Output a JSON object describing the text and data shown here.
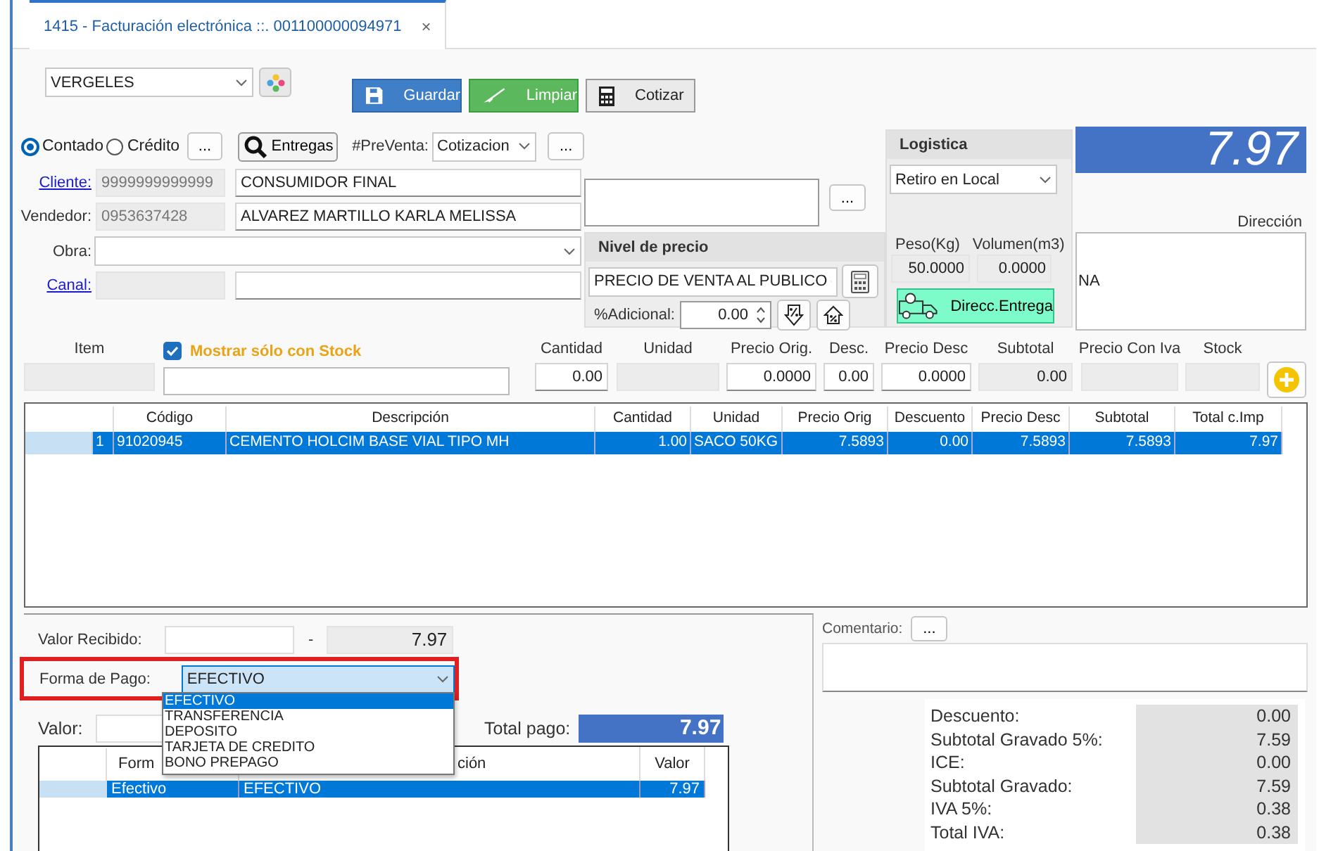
{
  "tab": {
    "title": "1415 - Facturación electrónica ::. 001100000094971",
    "close": "×",
    "selected": true
  },
  "branch": {
    "value": "VERGELES"
  },
  "toolbar": [
    {
      "kind": "save",
      "label": "Guardar"
    },
    {
      "kind": "clear",
      "label": "Limpiar"
    },
    {
      "kind": "quote",
      "label": "Cotizar"
    }
  ],
  "payment_terms": [
    {
      "label": "Contado",
      "selected": true
    },
    {
      "label": "Crédito",
      "selected": false
    }
  ],
  "terms_more": "...",
  "deliveries_button": "Entregas",
  "presale": {
    "label": "#PreVenta:",
    "value": "Cotizacion",
    "more": "..."
  },
  "customer": {
    "label": "Cliente:",
    "id": "9999999999999",
    "name": "CONSUMIDOR FINAL"
  },
  "seller": {
    "label": "Vendedor:",
    "id": "0953637428",
    "name": "ALVAREZ MARTILLO KARLA MELISSA"
  },
  "project": {
    "label": "Obra:"
  },
  "channel": {
    "label": "Canal:"
  },
  "notes_more": "...",
  "price_level": {
    "title": "Nivel de precio",
    "value": "PRECIO DE VENTA AL PUBLICO",
    "extra_label": "%Adicional:",
    "extra_value": "0.00"
  },
  "logistics": {
    "title": "Logistica",
    "mode": "Retiro en Local",
    "weight_label": "Peso(Kg)",
    "weight": "50.0000",
    "volume_label": "Volumen(m3)",
    "volume": "0.0000",
    "delivery_button": "Direcc.Entrega"
  },
  "total": "7.97",
  "address": {
    "label": "Dirección",
    "value": "NA"
  },
  "item_entry": {
    "item_label": "Item",
    "stock_filter": {
      "label": "Mostrar sólo con Stock",
      "checked": true
    },
    "fields": [
      {
        "label": "Cantidad",
        "value": "0.00",
        "disabled": false
      },
      {
        "label": "Unidad",
        "disabled": true
      },
      {
        "label": "Precio Orig.",
        "value": "0.0000",
        "disabled": false
      },
      {
        "label": "Desc.",
        "value": "0.00",
        "disabled": false
      },
      {
        "label": "Precio Desc",
        "value": "0.0000",
        "disabled": false
      },
      {
        "label": "Subtotal",
        "value": "0.00",
        "disabled": true
      },
      {
        "label": "Precio Con Iva",
        "disabled": true
      },
      {
        "label": "Stock",
        "disabled": true
      }
    ]
  },
  "grid": {
    "columns": [
      "Código",
      "Descripción",
      "Cantidad",
      "Unidad",
      "Precio Orig",
      "Descuento",
      "Precio Desc",
      "Subtotal",
      "Total c.Imp"
    ],
    "rows": [
      {
        "selected": true,
        "number": "1",
        "cells": [
          "91020945",
          "CEMENTO HOLCIM BASE VIAL TIPO MH",
          "1.00",
          "SACO 50KG",
          "7.5893",
          "0.00",
          "7.5893",
          "7.5893",
          "7.97"
        ]
      }
    ]
  },
  "payment": {
    "received_label": "Valor Recibido:",
    "dash": "-",
    "due": "7.97",
    "method": {
      "label": "Forma de Pago:",
      "value": "EFECTIVO",
      "highlighted": true,
      "expanded": true,
      "options": [
        {
          "label": "EFECTIVO",
          "selected": true
        },
        {
          "label": "TRANSFERENCIA",
          "selected": false
        },
        {
          "label": "DEPOSITO",
          "selected": false
        },
        {
          "label": "TARJETA DE CREDITO",
          "selected": false
        },
        {
          "label": "BONO PREPAGO",
          "selected": false
        }
      ]
    },
    "amount_label": "Valor:",
    "total_label": "Total pago:",
    "total": "7.97",
    "table": {
      "columns": [
        "Form",
        "ción",
        "Valor"
      ],
      "rows": [
        {
          "selected": true,
          "cells": [
            "Efectivo",
            "EFECTIVO",
            "7.97"
          ]
        }
      ]
    }
  },
  "comment": {
    "label": "Comentario:",
    "more": "..."
  },
  "totals": [
    {
      "label": "Descuento:",
      "value": "0.00"
    },
    {
      "label": "Subtotal Gravado 5%:",
      "value": "7.59"
    },
    {
      "label": "ICE:",
      "value": "0.00"
    },
    {
      "label": "Subtotal Gravado:",
      "value": "7.59"
    },
    {
      "label": "IVA 5%:",
      "value": "0.38"
    },
    {
      "label": "Total IVA:",
      "value": "0.38"
    }
  ]
}
